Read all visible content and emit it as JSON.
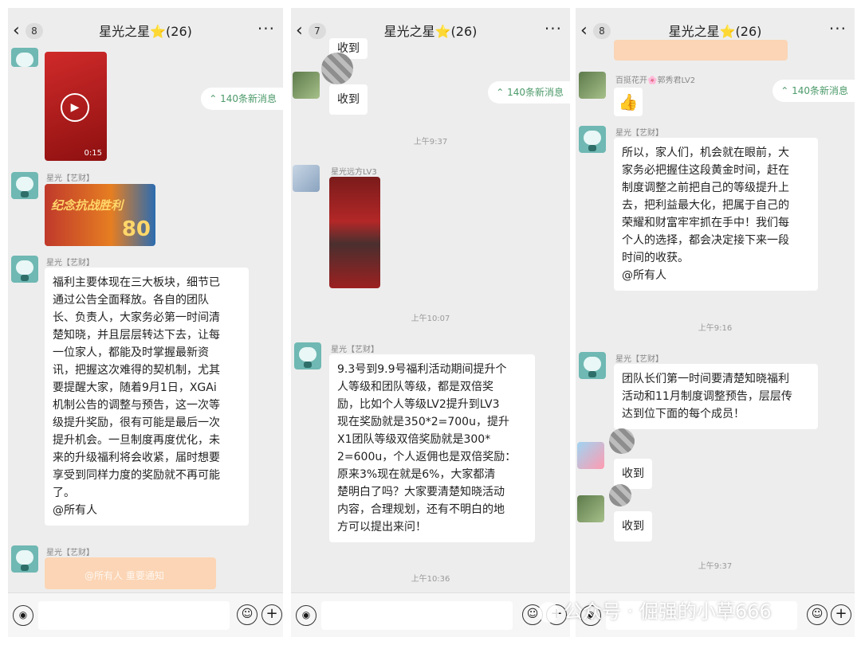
{
  "panels": [
    {
      "header": {
        "back": "‹",
        "unread": "8",
        "title": "星光之星",
        "star": "⭐",
        "count": "(26)",
        "more": "···"
      },
      "new_messages": "140条新消息",
      "video_duration": "0:15",
      "banner_text": "纪念抗战胜利",
      "banner_number": "80",
      "sender1": "星光【艺财】",
      "sender2": "星光【艺财】",
      "message": "福利主要体现在三大板块，细节已\n通过公告全面释放。各自的团队\n长、负责人，大家务必第一时间清\n楚知晓，并且层层转达下去，让每\n一位家人，都能及时掌握最新资\n讯，把握这次难得的契机制，尤其\n要提醒大家，随着9月1日，XGAi\n机制公告的调整与预告，这一次等\n级提升奖励，很有可能是最后一次\n提升机会。一旦制度再度优化，未\n来的升级福利将会收紧，届时想要\n享受到同样力度的奖励就不再可能\n了。\n@所有人",
      "sender3": "星光【艺财】",
      "partial_text": "@所有人 重要通知"
    },
    {
      "header": {
        "back": "‹",
        "unread": "7",
        "title": "星光之星",
        "star": "⭐",
        "count": "(26)",
        "more": "···"
      },
      "new_messages": "140条新消息",
      "received_top": "收到",
      "received": "收到",
      "time1": "上午9:37",
      "sender_lv3": "星光远方LV3",
      "time2": "上午10:07",
      "sender": "星光【艺财】",
      "message": "9.3号到9.9号福利活动期间提升个\n人等级和团队等级，都是双倍奖\n励，比如个人等级LV2提升到LV3\n现在奖励就是350*2=700u，提升\nX1团队等级双倍奖励就是300*\n2=600u，个人返佣也是双倍奖励：\n原来3%现在就是6%，大家都清\n楚明白了吗？大家要清楚知晓活动\n内容，合理规划，还有不明白的地\n方可以提出来问！",
      "time3": "上午10:36"
    },
    {
      "header": {
        "back": "‹",
        "unread": "8",
        "title": "星光之星",
        "star": "⭐",
        "count": "(26)",
        "more": "···"
      },
      "new_messages": "140条新消息",
      "sender_lv2": "百挺花开🌸郭秀君LV2",
      "sticker": "👍",
      "sender1": "星光【艺财】",
      "message1": "所以，家人们，机会就在眼前，大\n家务必把握住这段黄金时间，赶在\n制度调整之前把自己的等级提升上\n去，把利益最大化，把属于自己的\n荣耀和财富牢牢抓在手中！我们每\n个人的选择，都会决定接下来一段\n时间的收获。\n@所有人",
      "time1": "上午9:16",
      "sender2": "星光【艺财】",
      "message2": "团队长们第一时间要清楚知晓福利\n活动和11月制度调整预告，层层传\n达到位下面的每个成员！",
      "received1": "收到",
      "received2": "收到",
      "time2": "上午9:37"
    }
  ],
  "inputbar": {
    "voice": "◉",
    "emoji": "☺",
    "plus": "+"
  },
  "watermark": "公众号 · 倔强的小草666"
}
